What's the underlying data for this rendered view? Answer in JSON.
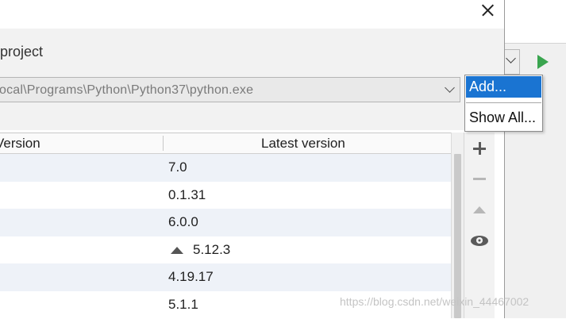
{
  "dialog": {
    "project_label": "project",
    "interpreter_path": "ocal\\Programs\\Python\\Python37\\python.exe"
  },
  "table": {
    "headers": {
      "version": "Version",
      "latest": "Latest version"
    },
    "rows": [
      {
        "latest": "7.0",
        "upgrade": false
      },
      {
        "latest": "0.1.31",
        "upgrade": false
      },
      {
        "latest": "6.0.0",
        "upgrade": false
      },
      {
        "latest": "5.12.3",
        "upgrade": true
      },
      {
        "latest": "4.19.17",
        "upgrade": false
      },
      {
        "latest": "5.1.1",
        "upgrade": false
      }
    ]
  },
  "tools": [
    "plus-icon",
    "minus-icon",
    "upgrade-icon",
    "eye-icon"
  ],
  "popup": {
    "add_label": "Add...",
    "show_all_label": "Show All..."
  },
  "watermark": "https://blog.csdn.net/weixin_44467002",
  "colors": {
    "selection": "#1a74d2",
    "run": "#3aa54f",
    "row_alt": "#eef2f8"
  }
}
